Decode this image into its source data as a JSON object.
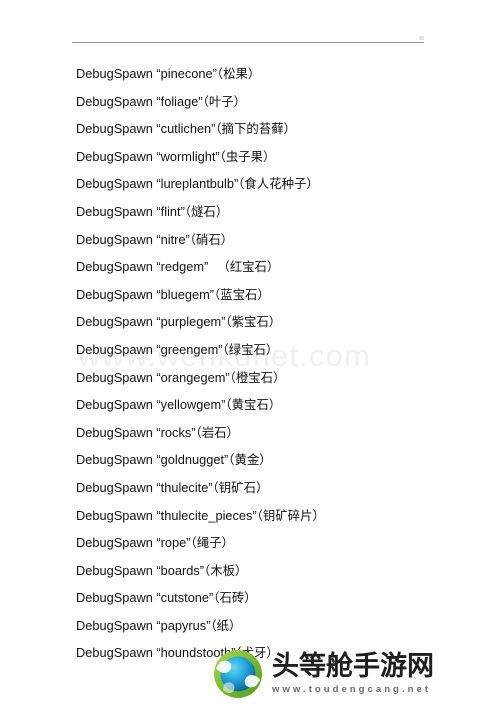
{
  "document": {
    "background_color": "#ffffff",
    "text_color": "#141414",
    "rule_color": "#9b9b9b"
  },
  "watermark": {
    "text": "www.wenkunet.com",
    "color": "#f0f0f0"
  },
  "commands": {
    "prefix": "DebugSpawn",
    "quote_open": "“",
    "quote_close": "”",
    "paren_open": "（",
    "paren_close": "）",
    "items": [
      {
        "prefix": "DebugSpawn",
        "id": "pinecone",
        "cn": "松果",
        "extra_gap": false
      },
      {
        "prefix": "DebugSpawn",
        "id": "foliage",
        "cn": "叶子",
        "extra_gap": false
      },
      {
        "prefix": "DebugSpawn",
        "id": "cutlichen",
        "cn": "摘下的苔藓",
        "extra_gap": false
      },
      {
        "prefix": "DebugSpawn",
        "id": "wormlight",
        "cn": "虫子果",
        "extra_gap": false
      },
      {
        "prefix": "DebugSpawn",
        "id": "lureplantbulb",
        "cn": "食人花种子",
        "extra_gap": false
      },
      {
        "prefix": "DebugSpawn",
        "id": "flint",
        "cn": "燧石",
        "extra_gap": false
      },
      {
        "prefix": "DebugSpawn",
        "id": "nitre",
        "cn": "硝石",
        "extra_gap": false
      },
      {
        "prefix": "DebugSpawn",
        "id": "redgem",
        "cn": "红宝石",
        "extra_gap": true
      },
      {
        "prefix": "DebugSpawn",
        "id": "bluegem",
        "cn": "蓝宝石",
        "extra_gap": false
      },
      {
        "prefix": "DebugSpawn",
        "id": "purplegem",
        "cn": "紫宝石",
        "extra_gap": false
      },
      {
        "prefix": "DebugSpawn",
        "id": "greengem",
        "cn": "绿宝石",
        "extra_gap": false
      },
      {
        "prefix": "DebugSpawn",
        "id": "orangegem",
        "cn": "橙宝石",
        "extra_gap": false
      },
      {
        "prefix": "DebugSpawn",
        "id": "yellowgem",
        "cn": "黄宝石",
        "extra_gap": false
      },
      {
        "prefix": "DebugSpawn",
        "id": "rocks",
        "cn": "岩石",
        "extra_gap": false
      },
      {
        "prefix": "DebugSpawn",
        "id": "goldnugget",
        "cn": "黄金",
        "extra_gap": false
      },
      {
        "prefix": "DebugSpawn",
        "id": "thulecite",
        "cn": "钥矿石",
        "extra_gap": false
      },
      {
        "prefix": "DebugSpawn",
        "id": "thulecite_pieces",
        "cn": "钥矿碎片",
        "extra_gap": false
      },
      {
        "prefix": "DebugSpawn",
        "id": "rope",
        "cn": "绳子",
        "extra_gap": false
      },
      {
        "prefix": "DebugSpawn",
        "id": "boards",
        "cn": "木板",
        "extra_gap": false
      },
      {
        "prefix": "DebugSpawn",
        "id": "cutstone",
        "cn": "石砖",
        "extra_gap": false
      },
      {
        "prefix": "DebugSpawn",
        "id": "papyrus",
        "cn": "纸",
        "extra_gap": false
      },
      {
        "prefix": "DebugSpawn",
        "id": "houndstooth",
        "cn": "犬牙",
        "extra_gap": false
      }
    ]
  },
  "brand": {
    "title": "头等舱手游网",
    "url": "www.toudengcang.net",
    "globe_green": "#8cc63f",
    "globe_blue": "#1b9fd8",
    "title_color": "#1f1f1f",
    "url_color": "#6d6d6d"
  }
}
